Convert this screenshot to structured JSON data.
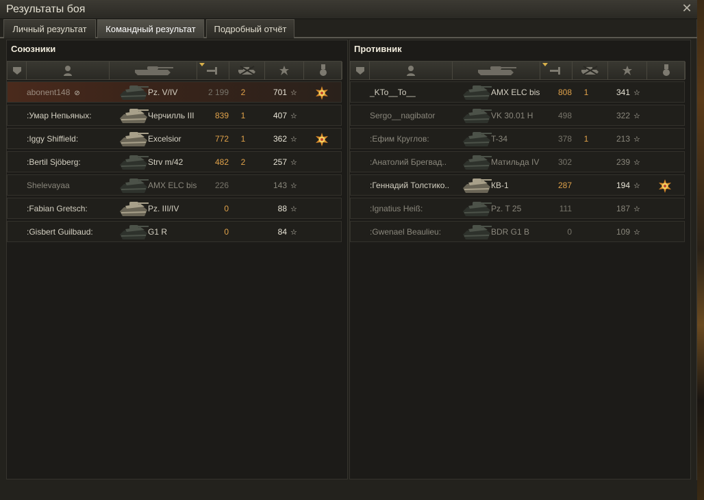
{
  "window": {
    "title": "Результаты боя",
    "close_icon": "close-icon"
  },
  "tabs": [
    {
      "label": "Личный результат",
      "active": false
    },
    {
      "label": "Командный результат",
      "active": true
    },
    {
      "label": "Подробный отчёт",
      "active": false
    }
  ],
  "colors": {
    "damage": "#e0a24a",
    "self_row": "#4a2a1c",
    "panel": "#1c1b18"
  },
  "allies": {
    "title": "Союзники",
    "rows": [
      {
        "name": "abonent148",
        "tank": "Pz. V/IV",
        "damage": "2 199",
        "kills": "2",
        "xp": "701",
        "medal": true,
        "self": true,
        "dead": false
      },
      {
        "name": ":Умар Непьяных:",
        "tank": "Черчилль III",
        "damage": "839",
        "kills": "1",
        "xp": "407",
        "medal": false,
        "self": false,
        "dead": false
      },
      {
        "name": ":Iggy Shiffield:",
        "tank": "Excelsior",
        "damage": "772",
        "kills": "1",
        "xp": "362",
        "medal": true,
        "self": false,
        "dead": false
      },
      {
        "name": ":Bertil Sjöberg:",
        "tank": "Strv m/42",
        "damage": "482",
        "kills": "2",
        "xp": "257",
        "medal": false,
        "self": false,
        "dead": false
      },
      {
        "name": "Shelevayaa",
        "tank": "AMX ELC bis",
        "damage": "226",
        "kills": "",
        "xp": "143",
        "medal": false,
        "self": false,
        "dead": true
      },
      {
        "name": ":Fabian Gretsch:",
        "tank": "Pz. III/IV",
        "damage": "0",
        "kills": "",
        "xp": "88",
        "medal": false,
        "self": false,
        "dead": false
      },
      {
        "name": ":Gisbert Guilbaud:",
        "tank": "G1 R",
        "damage": "0",
        "kills": "",
        "xp": "84",
        "medal": false,
        "self": false,
        "dead": false
      }
    ]
  },
  "enemies": {
    "title": "Противник",
    "rows": [
      {
        "name": "_KTo__To__",
        "tank": "AMX ELC bis",
        "damage": "808",
        "kills": "1",
        "xp": "341",
        "medal": false,
        "dead": false
      },
      {
        "name": "Sergo__nagibator",
        "tank": "VK 30.01 H",
        "damage": "498",
        "kills": "",
        "xp": "322",
        "medal": false,
        "dead": true
      },
      {
        "name": ":Ефим Круглов:",
        "tank": "T-34",
        "damage": "378",
        "kills": "1",
        "xp": "213",
        "medal": false,
        "dead": true
      },
      {
        "name": ":Анатолий Брегвад..",
        "tank": "Матильда IV",
        "damage": "302",
        "kills": "",
        "xp": "239",
        "medal": false,
        "dead": true
      },
      {
        "name": ":Геннадий Толстико..",
        "tank": "КВ-1",
        "damage": "287",
        "kills": "",
        "xp": "194",
        "medal": true,
        "dead": false
      },
      {
        "name": ":Ignatius Heiß:",
        "tank": "Pz. T 25",
        "damage": "111",
        "kills": "",
        "xp": "187",
        "medal": false,
        "dead": true
      },
      {
        "name": ":Gwenael Beaulieu:",
        "tank": "BDR G1 B",
        "damage": "0",
        "kills": "",
        "xp": "109",
        "medal": false,
        "dead": true
      }
    ]
  },
  "columns": [
    "squad-icon",
    "player-icon",
    "tank-icon",
    "damage-icon",
    "kills-icon",
    "xp-star-icon",
    "medal-icon"
  ],
  "star_glyph": "★"
}
